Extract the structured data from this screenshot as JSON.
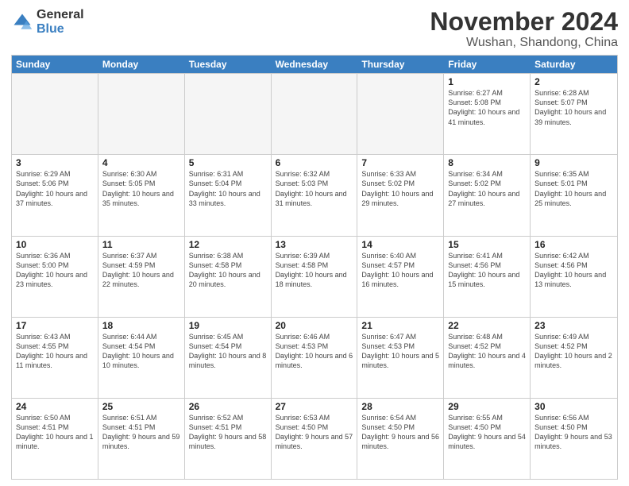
{
  "logo": {
    "general": "General",
    "blue": "Blue"
  },
  "title": "November 2024",
  "location": "Wushan, Shandong, China",
  "header_days": [
    "Sunday",
    "Monday",
    "Tuesday",
    "Wednesday",
    "Thursday",
    "Friday",
    "Saturday"
  ],
  "weeks": [
    [
      {
        "day": "",
        "info": "",
        "empty": true
      },
      {
        "day": "",
        "info": "",
        "empty": true
      },
      {
        "day": "",
        "info": "",
        "empty": true
      },
      {
        "day": "",
        "info": "",
        "empty": true
      },
      {
        "day": "",
        "info": "",
        "empty": true
      },
      {
        "day": "1",
        "info": "Sunrise: 6:27 AM\nSunset: 5:08 PM\nDaylight: 10 hours and 41 minutes.",
        "empty": false
      },
      {
        "day": "2",
        "info": "Sunrise: 6:28 AM\nSunset: 5:07 PM\nDaylight: 10 hours and 39 minutes.",
        "empty": false
      }
    ],
    [
      {
        "day": "3",
        "info": "Sunrise: 6:29 AM\nSunset: 5:06 PM\nDaylight: 10 hours and 37 minutes.",
        "empty": false
      },
      {
        "day": "4",
        "info": "Sunrise: 6:30 AM\nSunset: 5:05 PM\nDaylight: 10 hours and 35 minutes.",
        "empty": false
      },
      {
        "day": "5",
        "info": "Sunrise: 6:31 AM\nSunset: 5:04 PM\nDaylight: 10 hours and 33 minutes.",
        "empty": false
      },
      {
        "day": "6",
        "info": "Sunrise: 6:32 AM\nSunset: 5:03 PM\nDaylight: 10 hours and 31 minutes.",
        "empty": false
      },
      {
        "day": "7",
        "info": "Sunrise: 6:33 AM\nSunset: 5:02 PM\nDaylight: 10 hours and 29 minutes.",
        "empty": false
      },
      {
        "day": "8",
        "info": "Sunrise: 6:34 AM\nSunset: 5:02 PM\nDaylight: 10 hours and 27 minutes.",
        "empty": false
      },
      {
        "day": "9",
        "info": "Sunrise: 6:35 AM\nSunset: 5:01 PM\nDaylight: 10 hours and 25 minutes.",
        "empty": false
      }
    ],
    [
      {
        "day": "10",
        "info": "Sunrise: 6:36 AM\nSunset: 5:00 PM\nDaylight: 10 hours and 23 minutes.",
        "empty": false
      },
      {
        "day": "11",
        "info": "Sunrise: 6:37 AM\nSunset: 4:59 PM\nDaylight: 10 hours and 22 minutes.",
        "empty": false
      },
      {
        "day": "12",
        "info": "Sunrise: 6:38 AM\nSunset: 4:58 PM\nDaylight: 10 hours and 20 minutes.",
        "empty": false
      },
      {
        "day": "13",
        "info": "Sunrise: 6:39 AM\nSunset: 4:58 PM\nDaylight: 10 hours and 18 minutes.",
        "empty": false
      },
      {
        "day": "14",
        "info": "Sunrise: 6:40 AM\nSunset: 4:57 PM\nDaylight: 10 hours and 16 minutes.",
        "empty": false
      },
      {
        "day": "15",
        "info": "Sunrise: 6:41 AM\nSunset: 4:56 PM\nDaylight: 10 hours and 15 minutes.",
        "empty": false
      },
      {
        "day": "16",
        "info": "Sunrise: 6:42 AM\nSunset: 4:56 PM\nDaylight: 10 hours and 13 minutes.",
        "empty": false
      }
    ],
    [
      {
        "day": "17",
        "info": "Sunrise: 6:43 AM\nSunset: 4:55 PM\nDaylight: 10 hours and 11 minutes.",
        "empty": false
      },
      {
        "day": "18",
        "info": "Sunrise: 6:44 AM\nSunset: 4:54 PM\nDaylight: 10 hours and 10 minutes.",
        "empty": false
      },
      {
        "day": "19",
        "info": "Sunrise: 6:45 AM\nSunset: 4:54 PM\nDaylight: 10 hours and 8 minutes.",
        "empty": false
      },
      {
        "day": "20",
        "info": "Sunrise: 6:46 AM\nSunset: 4:53 PM\nDaylight: 10 hours and 6 minutes.",
        "empty": false
      },
      {
        "day": "21",
        "info": "Sunrise: 6:47 AM\nSunset: 4:53 PM\nDaylight: 10 hours and 5 minutes.",
        "empty": false
      },
      {
        "day": "22",
        "info": "Sunrise: 6:48 AM\nSunset: 4:52 PM\nDaylight: 10 hours and 4 minutes.",
        "empty": false
      },
      {
        "day": "23",
        "info": "Sunrise: 6:49 AM\nSunset: 4:52 PM\nDaylight: 10 hours and 2 minutes.",
        "empty": false
      }
    ],
    [
      {
        "day": "24",
        "info": "Sunrise: 6:50 AM\nSunset: 4:51 PM\nDaylight: 10 hours and 1 minute.",
        "empty": false
      },
      {
        "day": "25",
        "info": "Sunrise: 6:51 AM\nSunset: 4:51 PM\nDaylight: 9 hours and 59 minutes.",
        "empty": false
      },
      {
        "day": "26",
        "info": "Sunrise: 6:52 AM\nSunset: 4:51 PM\nDaylight: 9 hours and 58 minutes.",
        "empty": false
      },
      {
        "day": "27",
        "info": "Sunrise: 6:53 AM\nSunset: 4:50 PM\nDaylight: 9 hours and 57 minutes.",
        "empty": false
      },
      {
        "day": "28",
        "info": "Sunrise: 6:54 AM\nSunset: 4:50 PM\nDaylight: 9 hours and 56 minutes.",
        "empty": false
      },
      {
        "day": "29",
        "info": "Sunrise: 6:55 AM\nSunset: 4:50 PM\nDaylight: 9 hours and 54 minutes.",
        "empty": false
      },
      {
        "day": "30",
        "info": "Sunrise: 6:56 AM\nSunset: 4:50 PM\nDaylight: 9 hours and 53 minutes.",
        "empty": false
      }
    ]
  ]
}
